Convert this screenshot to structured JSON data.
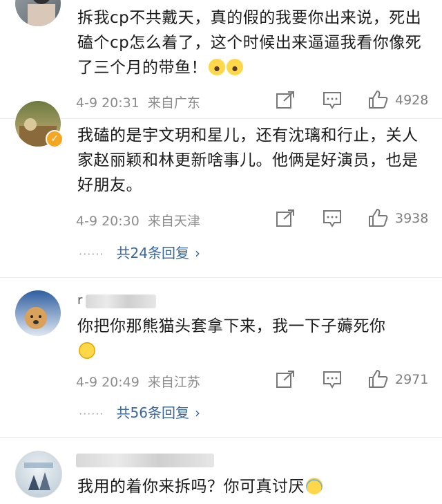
{
  "comments": [
    {
      "text": "拆我cp不共戴天，真的假的我要你出来说，死出磕个cp怎么着了，这个时候出来逼逼我看你像死了三个月的带鱼！",
      "emoji": "astonished-emoji",
      "time": "4-9 20:31",
      "location": "来自广东",
      "likes": "4928"
    },
    {
      "text": "我磕的是宇文玥和星儿，还有沈璃和行止，关人家赵丽颖和林更新啥事儿。他俩是好演员，也是好朋友。",
      "time": "4-9 20:30",
      "location": "来自天津",
      "likes": "3938",
      "replies": "共24条回复"
    },
    {
      "username_partial": "r",
      "text": "你把你那熊猫头套拿下来，我一下子薅死你",
      "emoji": "thinking-emoji",
      "time": "4-9 20:49",
      "location": "来自江苏",
      "likes": "2971",
      "replies": "共56条回复"
    },
    {
      "text": "我用的着你来拆吗？你可真讨厌",
      "emoji": "laughing-tears-emoji"
    }
  ],
  "icons": {
    "share": "share-icon",
    "comment": "comment-icon",
    "like": "like-icon",
    "reply_arrow": "chevron-right-icon"
  },
  "colors": {
    "reply_link": "#39669b",
    "meta": "#8c8c8c",
    "verified_badge": "#f5a623"
  }
}
